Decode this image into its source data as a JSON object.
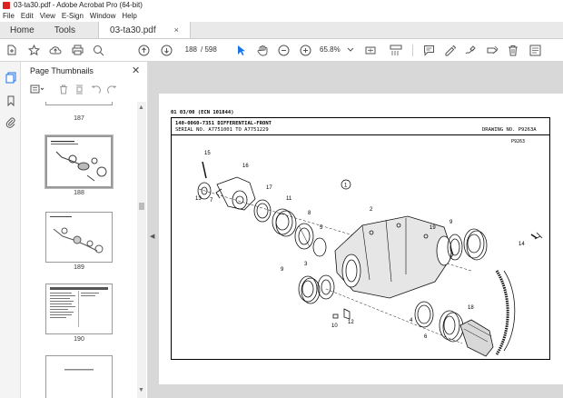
{
  "window": {
    "title": "03-ta30.pdf - Adobe Acrobat Pro (64-bit)"
  },
  "menu": [
    "File",
    "Edit",
    "View",
    "E-Sign",
    "Window",
    "Help"
  ],
  "tabs": {
    "home": "Home",
    "tools": "Tools",
    "document": "03-ta30.pdf",
    "close": "×"
  },
  "toolbar": {
    "current_page": "188",
    "total_pages": "/ 598",
    "zoom": "65.8%"
  },
  "panel": {
    "title": "Page Thumbnails",
    "thumbnails": [
      {
        "label": "187"
      },
      {
        "label": "188",
        "selected": true
      },
      {
        "label": "189"
      },
      {
        "label": "190"
      }
    ]
  },
  "document_page": {
    "group_code": "01 03/00 (ECN 101844)",
    "part_title": "140-0060-7351 DIFFERENTIAL-FRONT",
    "serial_range": "SERIAL NO. A7751001 TO A7751229",
    "drawing_no": "DRAWING NO. P9263A",
    "drawing_ref": "P9263",
    "callouts": [
      "1",
      "2",
      "3",
      "4",
      "5",
      "6",
      "7",
      "8",
      "9",
      "9",
      "10",
      "11",
      "12",
      "13",
      "14",
      "15",
      "16",
      "17",
      "18",
      "19"
    ]
  },
  "colors": {
    "accent": "#1a73e8",
    "viewer_bg": "#d8d8d8",
    "acrobat_red": "#d22"
  }
}
